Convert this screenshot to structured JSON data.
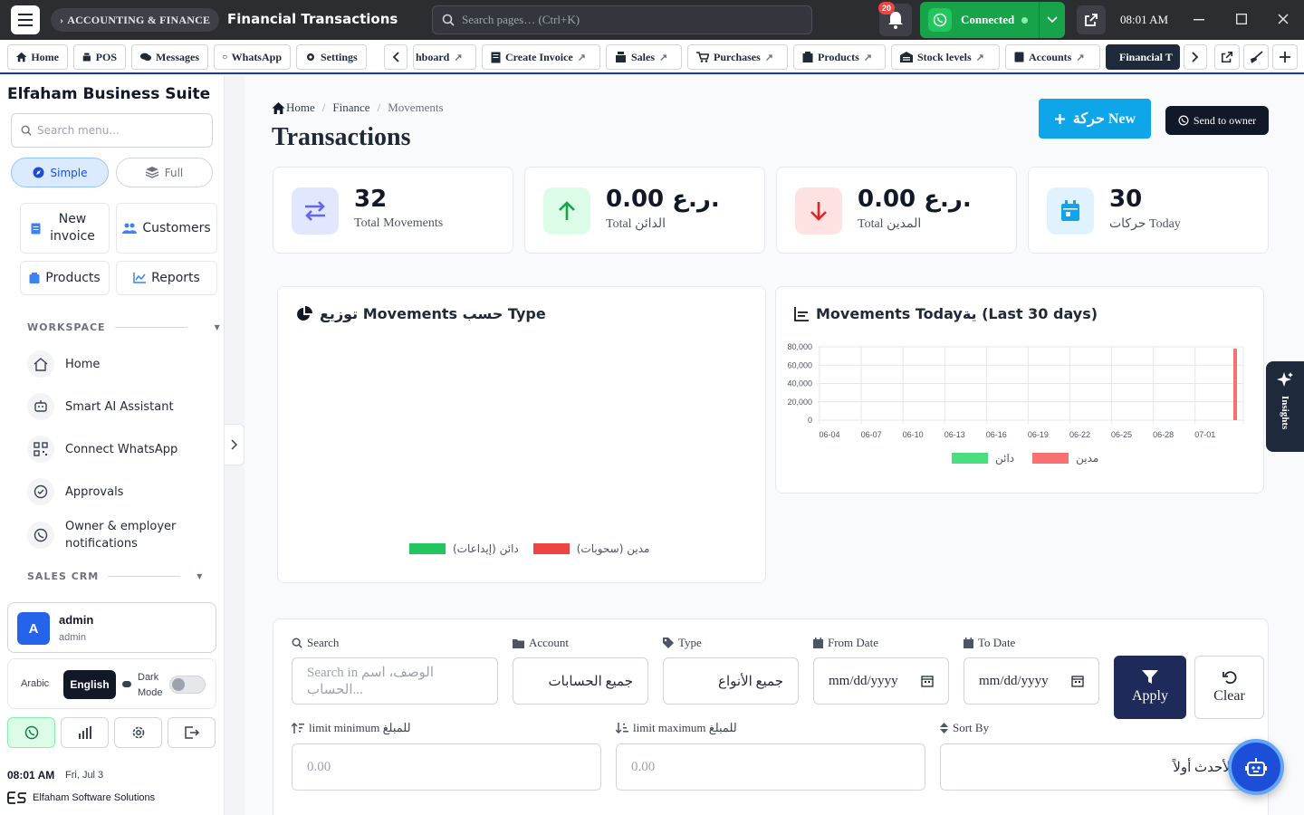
{
  "topbar": {
    "section": "ACCOUNTING & FINANCE",
    "title": "Financial Transactions",
    "search_placeholder": "Search pages… (Ctrl+K)",
    "notifications": "20",
    "whatsapp_status": "Connected",
    "time": "08:01 AM"
  },
  "tabs": {
    "pinned": [
      "Home",
      "POS",
      "Messages",
      "WhatsApp",
      "Settings"
    ],
    "open": [
      "hboard",
      "Create Invoice",
      "Sales",
      "Purchases",
      "Products",
      "Stock levels",
      "Accounts",
      "Financial T"
    ]
  },
  "sidebar": {
    "brand": "Elfaham Business Suite",
    "search_placeholder": "Search menu...",
    "mode_simple": "Simple",
    "mode_full": "Full",
    "quick": {
      "new_invoice": "New invoice",
      "customers": "Customers",
      "products": "Products",
      "reports": "Reports"
    },
    "workspace_heading": "WORKSPACE",
    "items": [
      "Home",
      "Smart AI Assistant",
      "Connect WhatsApp",
      "Approvals",
      "Owner & employer notifications"
    ],
    "sales_heading": "SALES CRM",
    "user": {
      "initial": "A",
      "name": "admin",
      "role": "admin"
    },
    "lang": {
      "arabic": "Arabic",
      "english": "English",
      "dark_mode": "Dark Mode"
    },
    "footer": {
      "time": "08:01 AM",
      "date": "Fri, Jul 3",
      "company": "Elfaham Software Solutions"
    }
  },
  "main": {
    "breadcrumb": [
      "Home",
      "Finance",
      "Movements"
    ],
    "title": "Transactions",
    "new_button": "حركة New",
    "send_button": "Send to owner",
    "stats": [
      {
        "value": "32",
        "label": "Total Movements"
      },
      {
        "value": "0.00 ر.ع.",
        "label": "Total الدائن"
      },
      {
        "value": "0.00 ر.ع.",
        "label": "Total المدين"
      },
      {
        "value": "30",
        "label": "حركات Today"
      }
    ],
    "pie_title": "توزيع Movements حسب Type",
    "pie_legend": [
      "دائن (إيداعات)",
      "مدين (سحوبات)"
    ],
    "line_title": "Movements Todayية (Last 30 days)",
    "line_legend": [
      "دائن",
      "مدين"
    ]
  },
  "chart_data": {
    "type": "bar",
    "title": "Movements Todayية (Last 30 days)",
    "x_ticks": [
      "06-04",
      "06-07",
      "06-10",
      "06-13",
      "06-16",
      "06-19",
      "06-22",
      "06-25",
      "06-28",
      "07-01"
    ],
    "y_ticks": [
      "80,000",
      "60,000",
      "40,000",
      "20,000",
      "0"
    ],
    "ylim": [
      0,
      80000
    ],
    "series": [
      {
        "name": "دائن",
        "color": "#4ade80",
        "values": [
          {
            "x": "07-03",
            "y": 0
          }
        ]
      },
      {
        "name": "مدين",
        "color": "#f87171",
        "values": [
          {
            "x": "07-03",
            "y": 78000
          }
        ]
      }
    ]
  },
  "filters": {
    "search_label": "Search",
    "search_placeholder": "Search in الوصف، اسم الحساب...",
    "account_label": "Account",
    "account_value": "جميع الحسابات",
    "type_label": "Type",
    "type_value": "جميع الأنواع",
    "from_label": "From Date",
    "to_label": "To Date",
    "date_placeholder": "mm/dd/yyyy",
    "apply": "Apply",
    "clear": "Clear",
    "min_label": "limit minimum للمبلغ",
    "max_label": "limit maximum للمبلغ",
    "min_value": "0.00",
    "max_value": "0.00",
    "sort_label": "Sort By",
    "sort_value": "الأحدث أولاً"
  },
  "insights": "Insights"
}
